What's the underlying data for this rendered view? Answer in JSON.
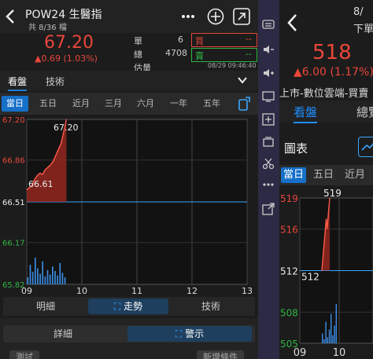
{
  "left": {
    "title": "POW24 生醫指",
    "subtitle": "共 8/36 檔",
    "price": "67.20",
    "change": "▲0.69 (1.03%)",
    "labels": {
      "single": "單",
      "total": "總",
      "est": "估量"
    },
    "single_value": "6",
    "total_value": "4708",
    "buy_label": "買",
    "buy_value": "--",
    "sell_label": "賣",
    "sell_value": "--",
    "timestamp": "08/29 09:46:40",
    "view_tabs": [
      "看盤",
      "技術"
    ],
    "period_tabs": [
      "當日",
      "五日",
      "近月",
      "三月",
      "六月",
      "一年",
      "五年"
    ],
    "chart_data": {
      "type": "area",
      "title": "",
      "xlabel": "",
      "ylabel": "",
      "x_ticks": [
        "09",
        "10",
        "11",
        "12",
        "13"
      ],
      "y_ticks": [
        "67.20",
        "66.86",
        "66.51",
        "66.17",
        "65.82"
      ],
      "ylim": [
        65.82,
        67.2
      ],
      "reference": 66.51,
      "price_high_label": "67.20",
      "price_low_label": "66.61",
      "series": [
        {
          "values": [
            66.61,
            66.63,
            66.65,
            66.7,
            66.73,
            66.75,
            66.74,
            66.78,
            66.8,
            66.82,
            66.85,
            66.9,
            66.95,
            67.0,
            67.1,
            67.2
          ]
        }
      ],
      "volume_bars": [
        8,
        22,
        14,
        30,
        18,
        12,
        26,
        9,
        16,
        11,
        20,
        15,
        10,
        24,
        13,
        8
      ]
    },
    "mode_buttons": [
      "明細",
      "走勢",
      "技術"
    ],
    "bottom_buttons": [
      "詳細",
      "警示"
    ],
    "bottom_partial": [
      "測試",
      "新增條件"
    ],
    "more_icon": "more-icon",
    "plus_icon": "plus-icon",
    "expand_icon": "expand-icon"
  },
  "right": {
    "price": "518",
    "change": "▲6.00 (1.17%)",
    "corner_top": "8/",
    "corner_bottom": "下單",
    "subtitle": "上市-數位雲端-買賣",
    "view_tabs": [
      "看盤",
      "總覽"
    ],
    "sub_title": "圖表",
    "period_tabs": [
      "當日",
      "五日",
      "近月"
    ],
    "chart_data": {
      "type": "line",
      "y_ticks": [
        "519",
        "516",
        "512",
        "508",
        "505"
      ],
      "x_ticks": [
        "09",
        "10"
      ],
      "ylim": [
        505,
        519
      ],
      "high_label": "519",
      "low_label": "512",
      "series": [
        {
          "values": [
            512,
            513,
            514,
            515,
            516,
            517,
            516,
            517,
            518,
            519
          ]
        }
      ],
      "volume_bars": [
        10,
        4,
        22,
        6,
        14,
        30,
        8,
        18,
        40
      ]
    }
  }
}
